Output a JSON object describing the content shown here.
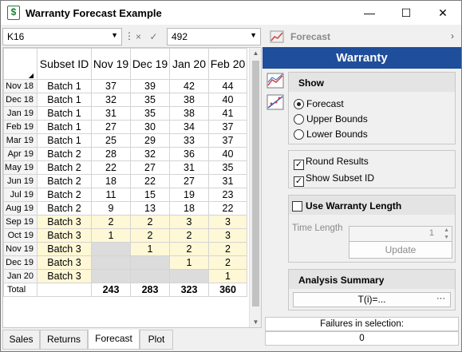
{
  "window": {
    "title": "Warranty Forecast Example",
    "minimize": "—",
    "maximize": "☐",
    "close": "✕",
    "app_icon": "$"
  },
  "formula_bar": {
    "cell_ref": "K16",
    "dots": "⋮",
    "cancel": "×",
    "confirm": "✓",
    "value": "492"
  },
  "grid": {
    "columns": [
      "Subset ID",
      "Nov 19",
      "Dec 19",
      "Jan 20",
      "Feb 20"
    ],
    "rows": [
      {
        "label": "Nov 18",
        "subset": "Batch 1",
        "v": [
          "37",
          "39",
          "42",
          "44"
        ]
      },
      {
        "label": "Dec 18",
        "subset": "Batch 1",
        "v": [
          "32",
          "35",
          "38",
          "40"
        ]
      },
      {
        "label": "Jan 19",
        "subset": "Batch 1",
        "v": [
          "31",
          "35",
          "38",
          "41"
        ]
      },
      {
        "label": "Feb 19",
        "subset": "Batch 1",
        "v": [
          "27",
          "30",
          "34",
          "37"
        ]
      },
      {
        "label": "Mar 19",
        "subset": "Batch 1",
        "v": [
          "25",
          "29",
          "33",
          "37"
        ]
      },
      {
        "label": "Apr 19",
        "subset": "Batch 2",
        "v": [
          "28",
          "32",
          "36",
          "40"
        ]
      },
      {
        "label": "May 19",
        "subset": "Batch 2",
        "v": [
          "22",
          "27",
          "31",
          "35"
        ]
      },
      {
        "label": "Jun 19",
        "subset": "Batch 2",
        "v": [
          "18",
          "22",
          "27",
          "31"
        ]
      },
      {
        "label": "Jul 19",
        "subset": "Batch 2",
        "v": [
          "11",
          "15",
          "19",
          "23"
        ]
      },
      {
        "label": "Aug 19",
        "subset": "Batch 2",
        "v": [
          "9",
          "13",
          "18",
          "22"
        ]
      },
      {
        "label": "Sep 19",
        "subset": "Batch 3",
        "v": [
          "2",
          "2",
          "3",
          "3"
        ]
      },
      {
        "label": "Oct 19",
        "subset": "Batch 3",
        "v": [
          "1",
          "2",
          "2",
          "3"
        ]
      },
      {
        "label": "Nov 19",
        "subset": "Batch 3",
        "v": [
          "",
          "1",
          "2",
          "2"
        ]
      },
      {
        "label": "Dec 19",
        "subset": "Batch 3",
        "v": [
          "",
          "",
          "1",
          "2"
        ]
      },
      {
        "label": "Jan 20",
        "subset": "Batch 3",
        "v": [
          "",
          "",
          "",
          "1"
        ]
      }
    ],
    "total": {
      "label": "Total",
      "v": [
        "243",
        "283",
        "323",
        "360"
      ]
    }
  },
  "tabs": [
    "Sales",
    "Returns",
    "Forecast",
    "Plot"
  ],
  "active_tab": "Forecast",
  "panel": {
    "header": "Forecast",
    "chevron": "›",
    "banner": "Warranty",
    "show": {
      "title": "Show",
      "options": [
        "Forecast",
        "Upper Bounds",
        "Lower Bounds"
      ],
      "selected": "Forecast"
    },
    "round_results": "Round Results",
    "show_subset": "Show Subset ID",
    "check_mark": "✓",
    "use_warranty_length": "Use Warranty Length",
    "time_length_label": "Time Length",
    "time_length_value": "1",
    "spin_up": "▲",
    "spin_down": "▼",
    "update_label": "Update",
    "analysis_summary": "Analysis Summary",
    "formula_label": "T(i)=...",
    "formula_more": "···",
    "failures_label": "Failures in selection:",
    "failures_value": "0"
  },
  "colors": {
    "banner": "#1f4e9a",
    "highlight": "#fff8d6",
    "gray_cell": "#dcdcdc"
  }
}
